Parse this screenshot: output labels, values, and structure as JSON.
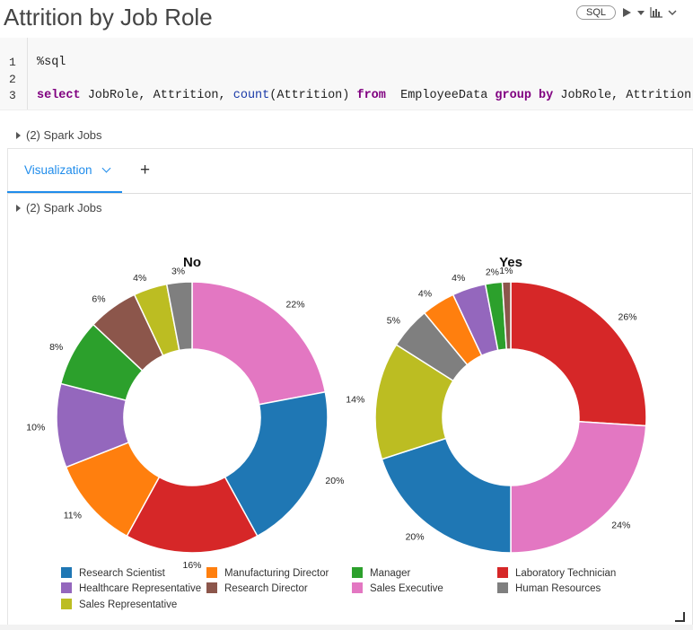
{
  "header": {
    "title": "Attrition by Job Role",
    "language_badge": "SQL"
  },
  "toolbar_icons": [
    "run-icon",
    "chevron-down-icon",
    "bar-chart-icon",
    "chevron-down-icon"
  ],
  "code": {
    "line_numbers": [
      "1",
      "2",
      "3"
    ],
    "line1": "%sql",
    "line3": {
      "kw_select": "select",
      "t1": " JobRole, Attrition, ",
      "fn_count": "count",
      "t2": "(Attrition) ",
      "kw_from": "from",
      "t3": "  EmployeeData ",
      "kw_group": "group",
      "t4": " ",
      "kw_by": "by",
      "t5": " JobRole, Attrition;"
    }
  },
  "spark_jobs_label": "(2) Spark Jobs",
  "viz": {
    "tab_label": "Visualization",
    "add_tab_symbol": "+"
  },
  "colors": {
    "Research Scientist": "#1f77b4",
    "Manufacturing Director": "#ff7f0e",
    "Manager": "#2ca02c",
    "Laboratory Technician": "#d62728",
    "Healthcare Representative": "#9467bd",
    "Research Director": "#8c564b",
    "Sales Executive": "#e377c2",
    "Human Resources": "#7f7f7f",
    "Sales Representative": "#bcbd22"
  },
  "chart_data": {
    "type": "pie",
    "donut": true,
    "legend_position": "bottom",
    "legend": [
      "Research Scientist",
      "Manufacturing Director",
      "Manager",
      "Laboratory Technician",
      "Healthcare Representative",
      "Research Director",
      "Sales Executive",
      "Human Resources",
      "Sales Representative"
    ],
    "charts": [
      {
        "title": "No",
        "slices": [
          {
            "label": "Sales Executive",
            "value": 22,
            "text": "22%"
          },
          {
            "label": "Research Scientist",
            "value": 20,
            "text": "20%"
          },
          {
            "label": "Laboratory Technician",
            "value": 16,
            "text": "16%"
          },
          {
            "label": "Manufacturing Director",
            "value": 11,
            "text": "11%"
          },
          {
            "label": "Healthcare Representative",
            "value": 10,
            "text": "10%"
          },
          {
            "label": "Manager",
            "value": 8,
            "text": "8%"
          },
          {
            "label": "Research Director",
            "value": 6,
            "text": "6%"
          },
          {
            "label": "Sales Representative",
            "value": 4,
            "text": "4%"
          },
          {
            "label": "Human Resources",
            "value": 3,
            "text": "3%"
          }
        ]
      },
      {
        "title": "Yes",
        "slices": [
          {
            "label": "Laboratory Technician",
            "value": 26,
            "text": "26%"
          },
          {
            "label": "Sales Executive",
            "value": 24,
            "text": "24%"
          },
          {
            "label": "Research Scientist",
            "value": 20,
            "text": "20%"
          },
          {
            "label": "Sales Representative",
            "value": 14,
            "text": "14%"
          },
          {
            "label": "Human Resources",
            "value": 5,
            "text": "5%"
          },
          {
            "label": "Manufacturing Director",
            "value": 4,
            "text": "4%"
          },
          {
            "label": "Healthcare Representative",
            "value": 4,
            "text": "4%"
          },
          {
            "label": "Manager",
            "value": 2,
            "text": "2%"
          },
          {
            "label": "Research Director",
            "value": 1,
            "text": "1%"
          }
        ]
      }
    ]
  }
}
